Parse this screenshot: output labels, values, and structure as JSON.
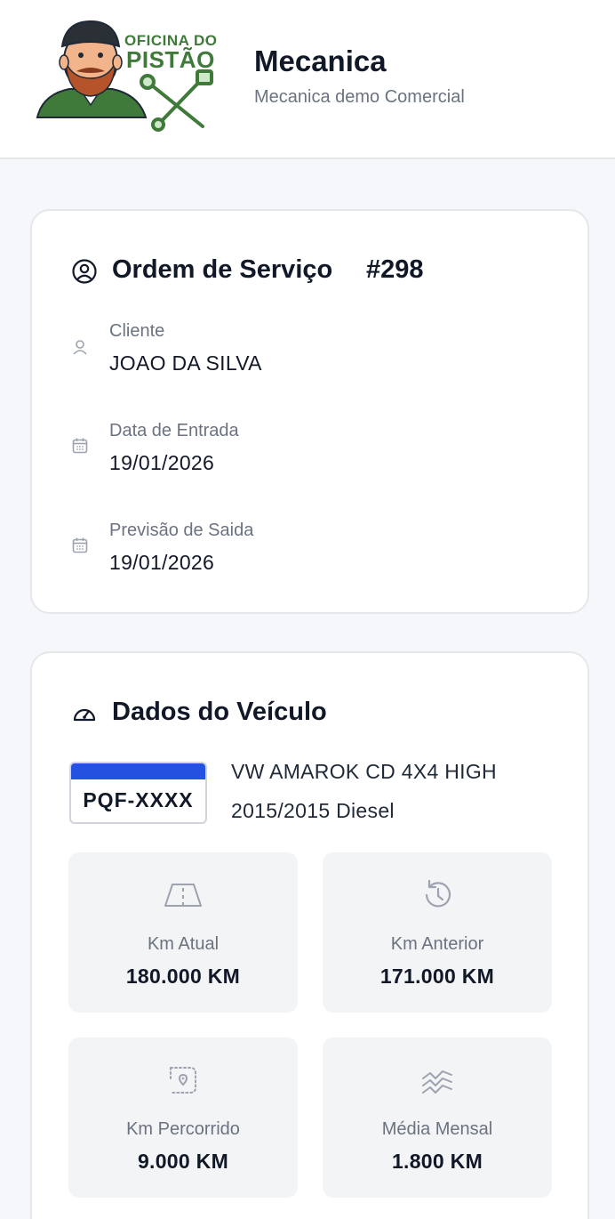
{
  "header": {
    "logo_line1": "OFICINA DO",
    "logo_line2": "PISTÃO",
    "company_name": "Mecanica",
    "company_subtitle": "Mecanica demo Comercial"
  },
  "order": {
    "title": "Ordem de Serviço",
    "number": "#298",
    "fields": [
      {
        "label": "Cliente",
        "value": "JOAO DA SILVA",
        "icon": "user-icon"
      },
      {
        "label": "Data de Entrada",
        "value": "19/01/2026",
        "icon": "calendar-icon"
      },
      {
        "label": "Previsão de Saida",
        "value": "19/01/2026",
        "icon": "calendar-icon"
      }
    ]
  },
  "vehicle": {
    "title": "Dados do Veículo",
    "plate": "PQF-XXXX",
    "model": "VW AMAROK CD 4X4 HIGH",
    "year_fuel": "2015/2015 Diesel",
    "stats": [
      {
        "label": "Km Atual",
        "value": "180.000 KM",
        "icon": "road-icon"
      },
      {
        "label": "Km Anterior",
        "value": "171.000 KM",
        "icon": "history-icon"
      },
      {
        "label": "Km Percorrido",
        "value": "9.000 KM",
        "icon": "route-icon"
      },
      {
        "label": "Média Mensal",
        "value": "1.800 KM",
        "icon": "trend-icon"
      }
    ]
  },
  "colors": {
    "accent_green": "#3f7a3a",
    "plate_blue": "#2451e0",
    "muted_text": "#6b7280"
  }
}
